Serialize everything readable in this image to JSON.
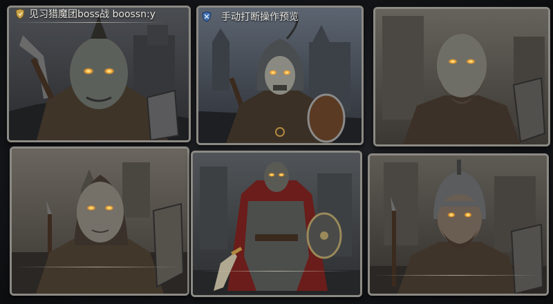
{
  "captions": {
    "left": "见习猎魔团boss战 boossn:y",
    "center": "手动打断操作预览"
  },
  "icons": {
    "left_badge": "gold-shield-icon",
    "center_badge": "blue-shield-icon"
  },
  "colors": {
    "frame": "#8c8a84",
    "eye_glow": "#ffb43a",
    "background": "#141518"
  },
  "cards": [
    {
      "name": "mohawk-orc-warrior"
    },
    {
      "name": "hooded-skull-knight"
    },
    {
      "name": "bald-bearded-brute"
    },
    {
      "name": "bald-hooded-brute"
    },
    {
      "name": "armored-red-cloak-warrior"
    },
    {
      "name": "helmeted-bearded-warrior"
    }
  ]
}
